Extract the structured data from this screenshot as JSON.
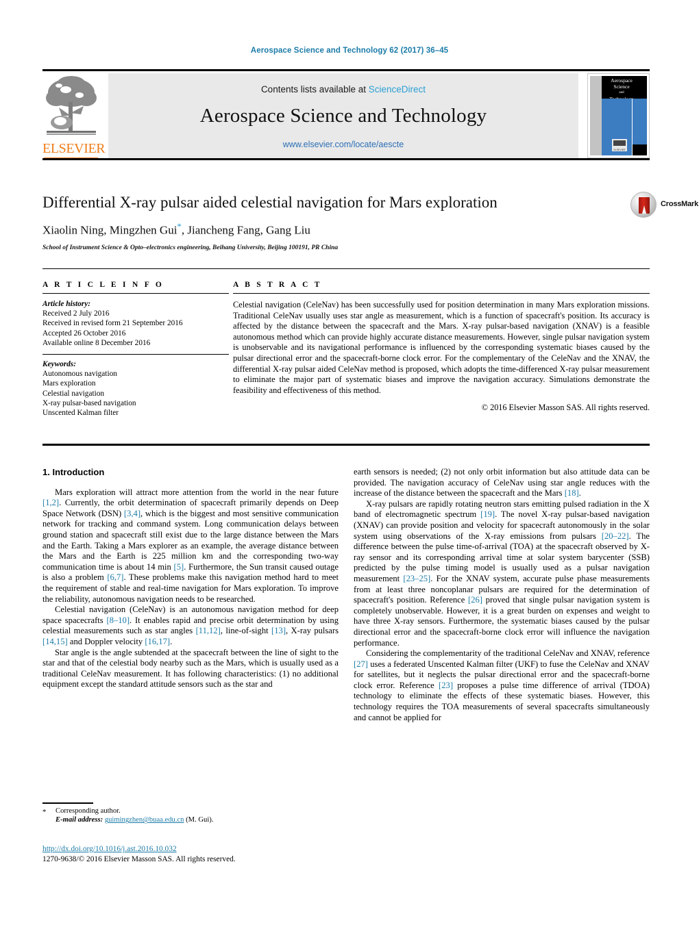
{
  "running_head": "Aerospace Science and Technology 62 (2017) 36–45",
  "masthead": {
    "contents_prefix": "Contents lists available at ",
    "sciencedirect": "ScienceDirect",
    "journal_title": "Aerospace Science and Technology",
    "journal_url": "www.elsevier.com/locate/aescte",
    "publisher": "ELSEVIER",
    "cover_title_line1": "Aerospace",
    "cover_title_line2": "Science",
    "cover_title_line3": "and",
    "cover_title_line4": "Technology",
    "cover_logo_text": "ELSEVIER"
  },
  "title_block": {
    "title": "Differential X-ray pulsar aided celestial navigation for Mars exploration",
    "authors_part1": "Xiaolin Ning, Mingzhen Gui",
    "corresponding_marker": "*",
    "authors_part2": ", Jiancheng Fang, Gang Liu",
    "affiliation": "School of Instrument Science & Opto–electronics engineering, Beihang University, Beijing 100191, PR China",
    "crossmark_label": "CrossMark"
  },
  "article_info": {
    "heading": "A R T I C L E   I N F O",
    "history_label": "Article history:",
    "history": [
      "Received 2 July 2016",
      "Received in revised form 21 September 2016",
      "Accepted 26 October 2016",
      "Available online 8 December 2016"
    ],
    "keywords_label": "Keywords:",
    "keywords": [
      "Autonomous navigation",
      "Mars exploration",
      "Celestial navigation",
      "X-ray pulsar-based navigation",
      "Unscented Kalman filter"
    ]
  },
  "abstract": {
    "heading": "A B S T R A C T",
    "text": "Celestial navigation (CeleNav) has been successfully used for position determination in many Mars exploration missions. Traditional CeleNav usually uses star angle as measurement, which is a function of spacecraft's position. Its accuracy is affected by the distance between the spacecraft and the Mars. X-ray pulsar-based navigation (XNAV) is a feasible autonomous method which can provide highly accurate distance measurements. However, single pulsar navigation system is unobservable and its navigational performance is influenced by the corresponding systematic biases caused by the pulsar directional error and the spacecraft-borne clock error. For the complementary of the CeleNav and the XNAV, the differential X-ray pulsar aided CeleNav method is proposed, which adopts the time-differenced X-ray pulsar measurement to eliminate the major part of systematic biases and improve the navigation accuracy. Simulations demonstrate the feasibility and effectiveness of this method.",
    "copyright": "© 2016 Elsevier Masson SAS. All rights reserved."
  },
  "body": {
    "section_heading": "1. Introduction",
    "left_paragraphs": [
      {
        "parts": [
          {
            "t": "Mars exploration will attract more attention from the world in the near future "
          },
          {
            "t": "[1,2]",
            "ref": true
          },
          {
            "t": ". Currently, the orbit determination of spacecraft primarily depends on Deep Space Network (DSN) "
          },
          {
            "t": "[3,4]",
            "ref": true
          },
          {
            "t": ", which is the biggest and most sensitive communication network for tracking and command system. Long communication delays between ground station and spacecraft still exist due to the large distance between the Mars and the Earth. Taking a Mars explorer as an example, the average distance between the Mars and the Earth is 225 million km and the corresponding two-way communication time is about 14 min "
          },
          {
            "t": "[5]",
            "ref": true
          },
          {
            "t": ". Furthermore, the Sun transit caused outage is also a problem "
          },
          {
            "t": "[6,7]",
            "ref": true
          },
          {
            "t": ". These problems make this navigation method hard to meet the requirement of stable and real-time navigation for Mars exploration. To improve the reliability, autonomous navigation needs to be researched."
          }
        ]
      },
      {
        "parts": [
          {
            "t": "Celestial navigation (CeleNav) is an autonomous navigation method for deep space spacecrafts "
          },
          {
            "t": "[8–10]",
            "ref": true
          },
          {
            "t": ". It enables rapid and precise orbit determination by using celestial measurements such as star angles "
          },
          {
            "t": "[11,12]",
            "ref": true
          },
          {
            "t": ", line-of-sight "
          },
          {
            "t": "[13]",
            "ref": true
          },
          {
            "t": ", X-ray pulsars "
          },
          {
            "t": "[14,15]",
            "ref": true
          },
          {
            "t": " and Doppler velocity "
          },
          {
            "t": "[16,17]",
            "ref": true
          },
          {
            "t": "."
          }
        ]
      },
      {
        "parts": [
          {
            "t": "Star angle is the angle subtended at the spacecraft between the line of sight to the star and that of the celestial body nearby such as the Mars, which is usually used as a traditional CeleNav measurement. It has following characteristics: (1) no additional equipment except the standard attitude sensors such as the star and"
          }
        ]
      }
    ],
    "right_paragraphs": [
      {
        "noindent": true,
        "parts": [
          {
            "t": "earth sensors is needed; (2) not only orbit information but also attitude data can be provided. The navigation accuracy of CeleNav using star angle reduces with the increase of the distance between the spacecraft and the Mars "
          },
          {
            "t": "[18]",
            "ref": true
          },
          {
            "t": "."
          }
        ]
      },
      {
        "parts": [
          {
            "t": "X-ray pulsars are rapidly rotating neutron stars emitting pulsed radiation in the X band of electromagnetic spectrum "
          },
          {
            "t": "[19]",
            "ref": true
          },
          {
            "t": ". The novel X-ray pulsar-based navigation (XNAV) can provide position and velocity for spacecraft autonomously in the solar system using observations of the X-ray emissions from pulsars "
          },
          {
            "t": "[20–22]",
            "ref": true
          },
          {
            "t": ". The difference between the pulse time-of-arrival (TOA) at the spacecraft observed by X-ray sensor and its corresponding arrival time at solar system barycenter (SSB) predicted by the pulse timing model is usually used as a pulsar navigation measurement "
          },
          {
            "t": "[23–25]",
            "ref": true
          },
          {
            "t": ". For the XNAV system, accurate pulse phase measurements from at least three noncoplanar pulsars are required for the determination of spacecraft's position. Reference "
          },
          {
            "t": "[26]",
            "ref": true
          },
          {
            "t": " proved that single pulsar navigation system is completely unobservable. However, it is a great burden on expenses and weight to have three X-ray sensors. Furthermore, the systematic biases caused by the pulsar directional error and the spacecraft-borne clock error will influence the navigation performance."
          }
        ]
      },
      {
        "parts": [
          {
            "t": "Considering the complementarity of the traditional CeleNav and XNAV, reference "
          },
          {
            "t": "[27]",
            "ref": true
          },
          {
            "t": " uses a federated Unscented Kalman filter (UKF) to fuse the CeleNav and XNAV for satellites, but it neglects the pulsar directional error and the spacecraft-borne clock error. Reference "
          },
          {
            "t": "[23]",
            "ref": true
          },
          {
            "t": " proposes a pulse time difference of arrival (TDOA) technology to eliminate the effects of these systematic biases. However, this technology requires the TOA measurements of several spacecrafts simultaneously and cannot be applied for"
          }
        ]
      }
    ]
  },
  "footnote": {
    "star": "*",
    "corresponding": "Corresponding author.",
    "email_label": "E-mail address:",
    "email": "guimingzhen@buaa.edu.cn",
    "email_suffix": "(M. Gui)."
  },
  "doi_block": {
    "doi": "http://dx.doi.org/10.1016/j.ast.2016.10.032",
    "issn_line": "1270-9638/© 2016 Elsevier Masson SAS. All rights reserved."
  },
  "colors": {
    "link_blue": "#1b7ba8",
    "sciencedirect_blue": "#2b9fd4",
    "elsevier_orange": "#ef7d1a",
    "cover_blue": "#3c7cc0"
  }
}
